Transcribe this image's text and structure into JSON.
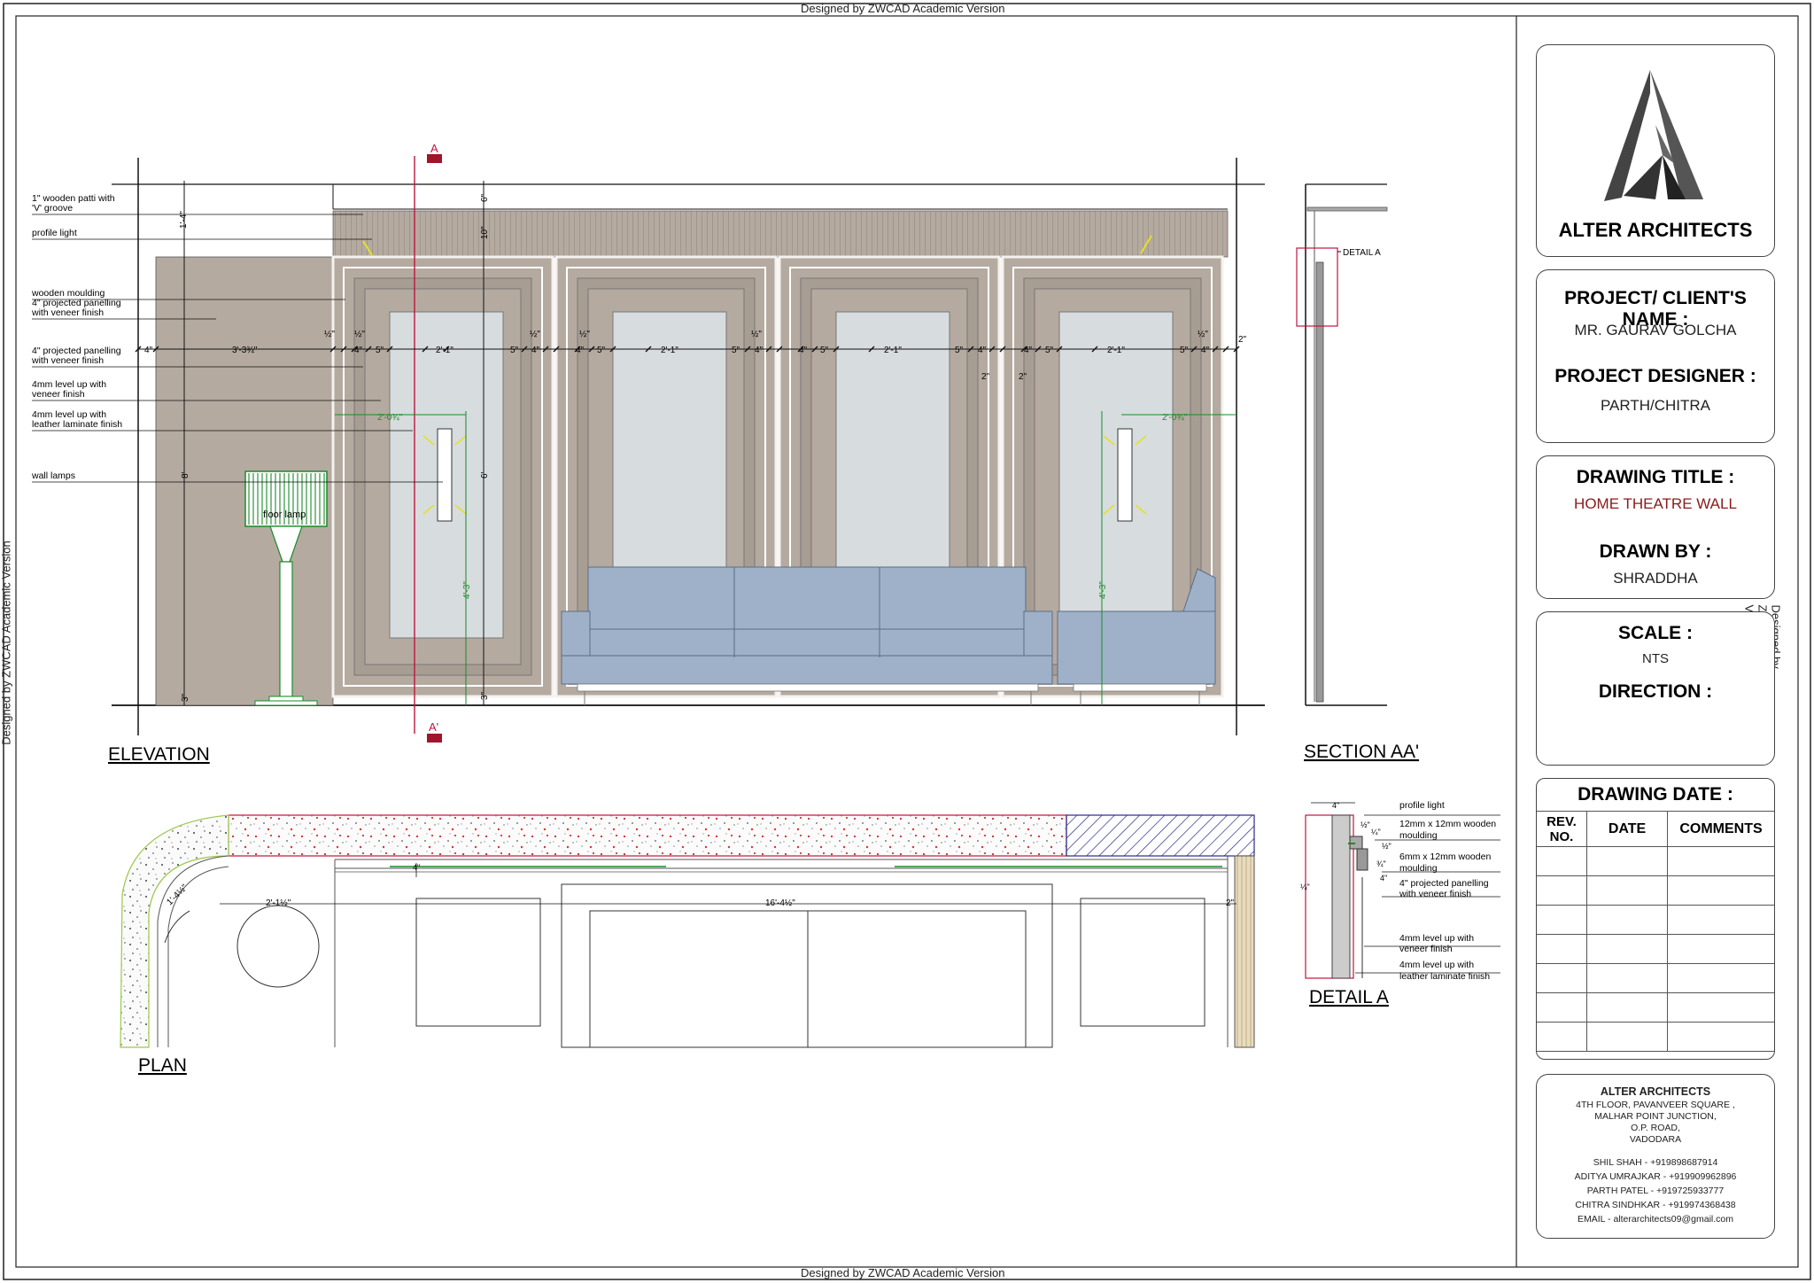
{
  "watermark": "Designed by ZWCAD Academic Version",
  "elevation": {
    "title": "ELEVATION",
    "section_marker_top": "A",
    "section_marker_bottom": "A'",
    "annotations": [
      "1\" wooden patti with",
      "'V' groove",
      "profile light",
      "wooden moulding",
      "4\" projected panelling",
      "with veneer finish",
      "4\" projected panelling",
      "with veneer finish",
      "4mm level up with",
      "veneer finish",
      "4mm level up with",
      "leather laminate finish",
      "wall lamps"
    ],
    "floor_lamp_label": "floor lamp",
    "dims": {
      "left_offset": "4\"",
      "left_panel": "3'-3¾\"",
      "panel_glass": "2'-1\"",
      "five": "5\"",
      "four": "4\"",
      "two": "2\"",
      "half": "½\"",
      "lamp_offset_left": "2'-0¾\"",
      "lamp_offset_right": "2'-0¾\"",
      "top_band": "1'-4\"",
      "height_total": "8'",
      "bottom": "3\"",
      "six": "6\"",
      "ten": "10\"",
      "height_mid": "6'",
      "lamp_height": "4'-3\"",
      "bottom_gap": "3\""
    }
  },
  "section": {
    "title": "SECTION AA'",
    "detail_callout": "DETAIL A"
  },
  "detail": {
    "title": "DETAIL A",
    "annotations": [
      "profile light",
      "12mm x 12mm wooden",
      "moulding",
      "6mm x 12mm wooden",
      "moulding",
      "4\" projected panelling",
      "with veneer finish",
      "4mm level up with",
      "veneer finish",
      "4mm level up with",
      "leather laminate finish"
    ],
    "dims": [
      "4\"",
      "½\"",
      "¼\"",
      "¼\"",
      "4\"",
      "½\"",
      "¾\""
    ]
  },
  "plan": {
    "title": "PLAN",
    "dims": {
      "radius": "1'-4½\"",
      "lamp": "2'-1½\"",
      "overall": "16'-4½\"",
      "right": "2\"",
      "top": "4\""
    }
  },
  "title_block": {
    "company": "ALTER ARCHITECTS",
    "project_label": "PROJECT/ CLIENT'S NAME :",
    "project_value": "MR. GAURAV GOLCHA",
    "designer_label": "PROJECT DESIGNER :",
    "designer_value": "PARTH/CHITRA",
    "drawing_title_label": "DRAWING TITLE :",
    "drawing_title_value": "HOME THEATRE WALL",
    "drawn_by_label": "DRAWN BY :",
    "drawn_by_value": "SHRADDHA",
    "scale_label": "SCALE :",
    "scale_value": "NTS",
    "direction_label": "DIRECTION :",
    "direction_value": "",
    "date_label": "DRAWING DATE :",
    "rev_headers": [
      "REV. NO.",
      "DATE",
      "COMMENTS"
    ],
    "rev_rows": 7,
    "office": {
      "name": "ALTER ARCHITECTS",
      "address": [
        "4TH FLOOR, PAVANVEER SQUARE ,",
        "MALHAR POINT JUNCTION,",
        "O.P. ROAD,",
        "VADODARA"
      ],
      "contacts": [
        "SHIL SHAH - +919898687914",
        "ADITYA UMRAJKAR - +919909962896",
        "PARTH PATEL - +919725933777",
        "CHITRA SINDHKAR - +919974368438",
        "EMAIL - alterarchitects09@gmail.com"
      ]
    }
  },
  "colors": {
    "panel": "#b5aaa0",
    "panel_dark": "#a89d92",
    "glass": "#d7dcde",
    "sofa": "#9fb1c8",
    "green": "#1a8a2a",
    "section_red": "#c0143c",
    "title_red": "#8b1a1a",
    "hatch_blue": "#2a2a8a"
  }
}
